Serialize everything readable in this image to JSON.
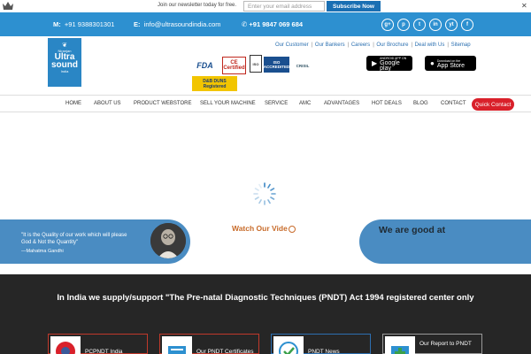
{
  "newsletter": {
    "text": "Join our newsletter today for free.",
    "email_placeholder": "Enter your email address",
    "subscribe_label": "Subscribe Now",
    "close_label": "✕"
  },
  "contact_bar": {
    "mobile_label": "M:",
    "mobile_value": "+91 9388301301",
    "email_label": "E:",
    "email_value": "info@ultrasoundindia.com",
    "whatsapp_value": "+91 9847 069 684",
    "social_icons": [
      "g+",
      "p",
      "t",
      "in",
      "yt",
      "f"
    ]
  },
  "logo": {
    "line1": "Niranjan",
    "line2": "Ultra",
    "line3": "sound",
    "line4": "India"
  },
  "top_links": [
    "Our Customer",
    "Our Bankers",
    "Careers",
    "Our Brochure",
    "Deal with Us",
    "Sitemap"
  ],
  "certifications": {
    "fda": "FDA",
    "ce": "CE Certified",
    "iso": "ISO",
    "iso_accredited": "ISO ACCREDITED",
    "crisil": "CRISIL",
    "duns": "D&B DUNS Registered"
  },
  "stores": {
    "google_small": "ANDROID APP ON",
    "google_big": "Google play",
    "apple_small": "Download on the",
    "apple_big": "App Store"
  },
  "nav": {
    "items": [
      "HOME",
      "ABOUT US",
      "PRODUCT WEBSTORE",
      "SELL YOUR MACHINE",
      "SERVICE",
      "AMC",
      "ADVANTAGES",
      "HOT DEALS",
      "BLOG",
      "CONTACT"
    ],
    "cta_label": "Quick Contact"
  },
  "quote": {
    "text": "\"It is the Quality of our work which will please God & Not the Quantity\"",
    "author": "—Mahatma Gandhi"
  },
  "video": {
    "label": "Watch Our Vide"
  },
  "good_at": {
    "title": "We are good at"
  },
  "pndt": {
    "heading": "In India we supply/support \"The Pre-natal Diagnostic Techniques (PNDT) Act 1994 registered center only",
    "cards": [
      {
        "label": "PCPNDT India",
        "border": "#c0392b"
      },
      {
        "label": "Our PNDT Certificates",
        "border": "#c0392b"
      },
      {
        "label": "PNDT News",
        "border": "#2d6fb0"
      },
      {
        "label": "Our Report to PNDT",
        "border": "#999999"
      }
    ]
  },
  "colors": {
    "primary_blue": "#2d90d0",
    "accent_red": "#d9202a",
    "panel_blue": "#4a8cc2",
    "dark_bg": "#262626"
  }
}
